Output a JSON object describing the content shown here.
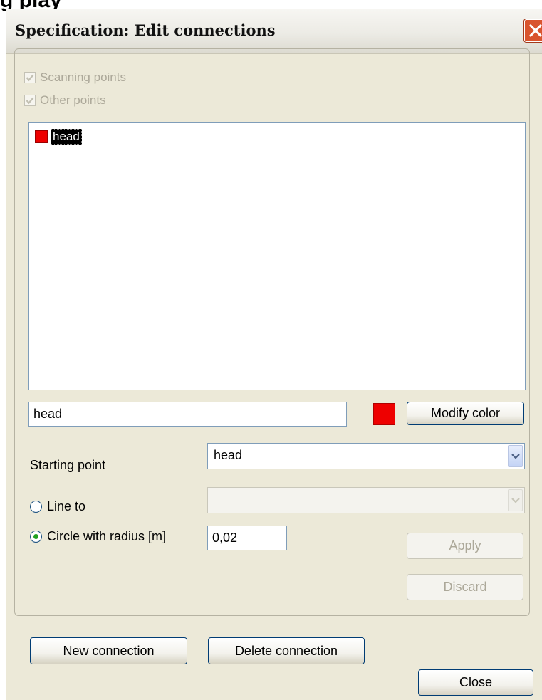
{
  "page_heading": "g  play",
  "window": {
    "title": "Specification: Edit connections"
  },
  "filters": {
    "scanning_points": {
      "label": "Scanning points",
      "checked": true,
      "enabled": false
    },
    "other_points": {
      "label": "Other points",
      "checked": true,
      "enabled": false
    }
  },
  "connections_list": [
    {
      "label": "head",
      "color": "#ee0000",
      "selected": true
    }
  ],
  "name_field": {
    "value": "head"
  },
  "color": {
    "value": "#ee0000",
    "modify_label": "Modify color"
  },
  "starting_point": {
    "label": "Starting point",
    "value": "head"
  },
  "line_to": {
    "label": "Line to",
    "value": "",
    "selected": false,
    "enabled": false
  },
  "circle": {
    "label": "Circle with radius [m]",
    "radius": "0,02",
    "selected": true
  },
  "buttons": {
    "apply": "Apply",
    "discard": "Discard",
    "new_connection": "New connection",
    "delete_connection": "Delete connection",
    "close": "Close"
  }
}
